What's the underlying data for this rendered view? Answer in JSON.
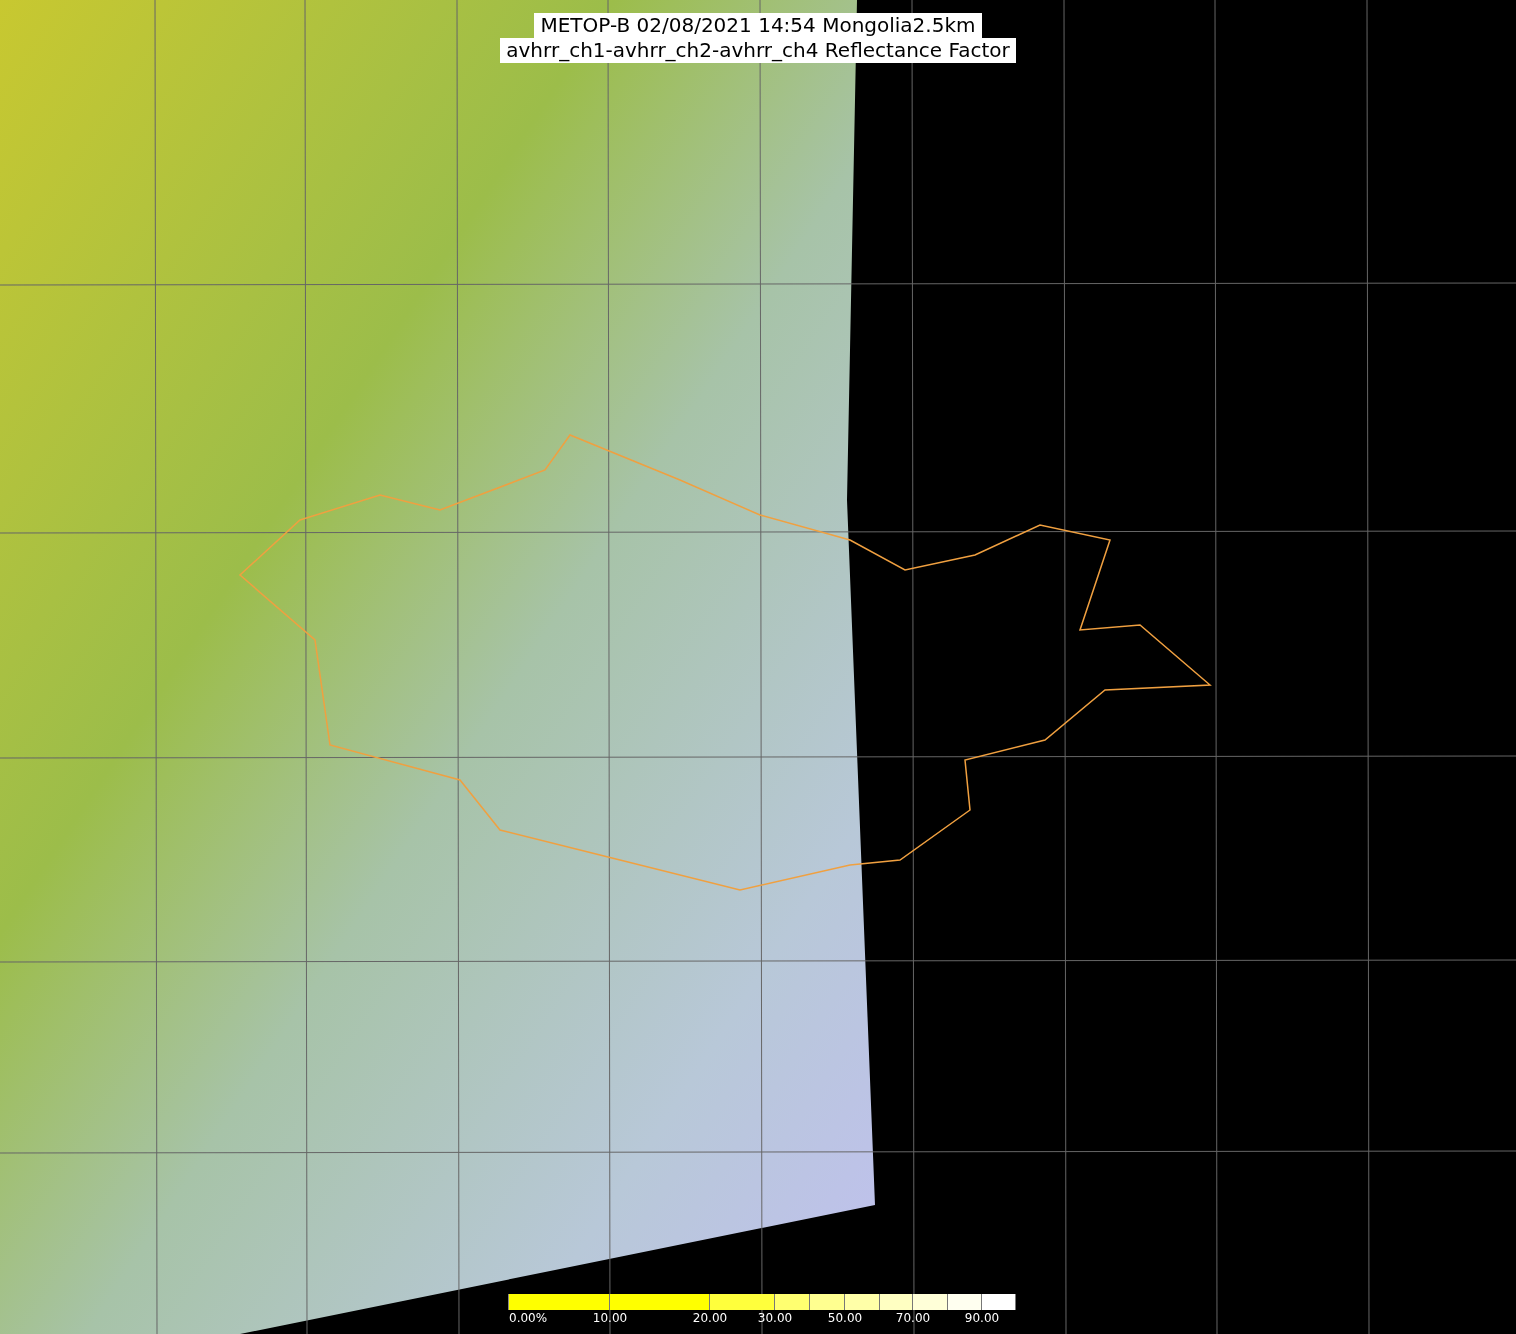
{
  "title": {
    "line_1": "METOP-B 02/08/2021 14:54 Mongolia2.5km",
    "line_2": "avhrr_ch1-avhrr_ch2-avhrr_ch4 Reflectance Factor"
  },
  "colorbar": {
    "segments": [
      {
        "color": "#ffff00",
        "label": "0.00%"
      },
      {
        "color": "#ffff00",
        "label": "10.00"
      },
      {
        "color": "#ffff3c",
        "label": "20.00"
      },
      {
        "color": "#ffff70",
        "label": "30.00"
      },
      {
        "color": "#ffff90"
      },
      {
        "color": "#ffffa8",
        "label": "50.00"
      },
      {
        "color": "#ffffc2"
      },
      {
        "color": "#ffffd8",
        "label": "70.00"
      },
      {
        "color": "#fffff0"
      },
      {
        "color": "#ffffff",
        "label": "90.00"
      }
    ]
  }
}
